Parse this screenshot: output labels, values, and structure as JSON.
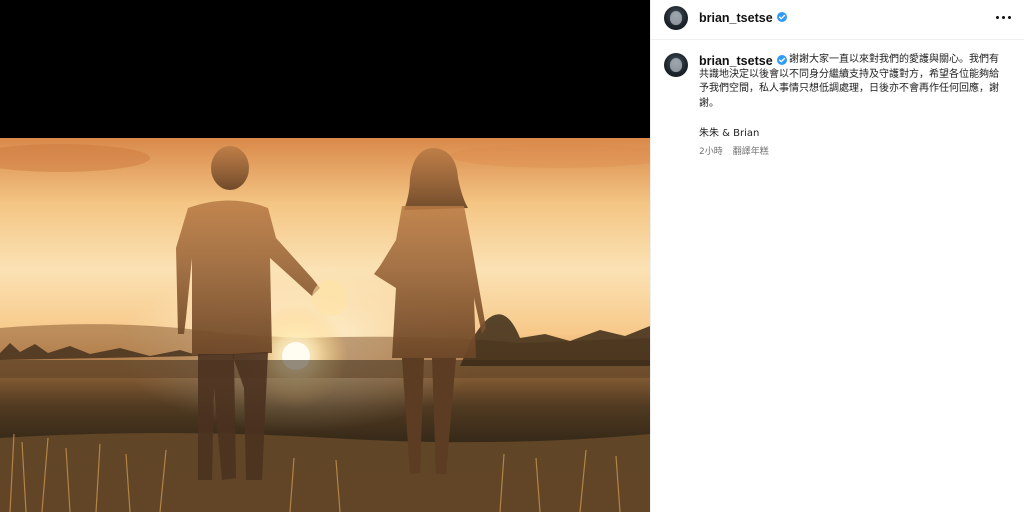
{
  "post": {
    "username": "brian_tsetse",
    "verified": true,
    "more_icon": "more-horizontal-icon",
    "caption": "謝謝大家一直以來對我們的愛護與關心。我們有共識地決定以後會以不同身分繼續支持及守護對方，希望各位能夠給予我們空間，私人事情只想低調處理，日後亦不會再作任何回應，謝謝。",
    "signoff": "朱朱 & Brian",
    "time": "2小時",
    "translate_label": "翻譯年糕"
  },
  "colors": {
    "verified_badge": "#2f9bf7",
    "username_text": "#111111",
    "meta_text": "#737373",
    "media_background": "#000000"
  }
}
